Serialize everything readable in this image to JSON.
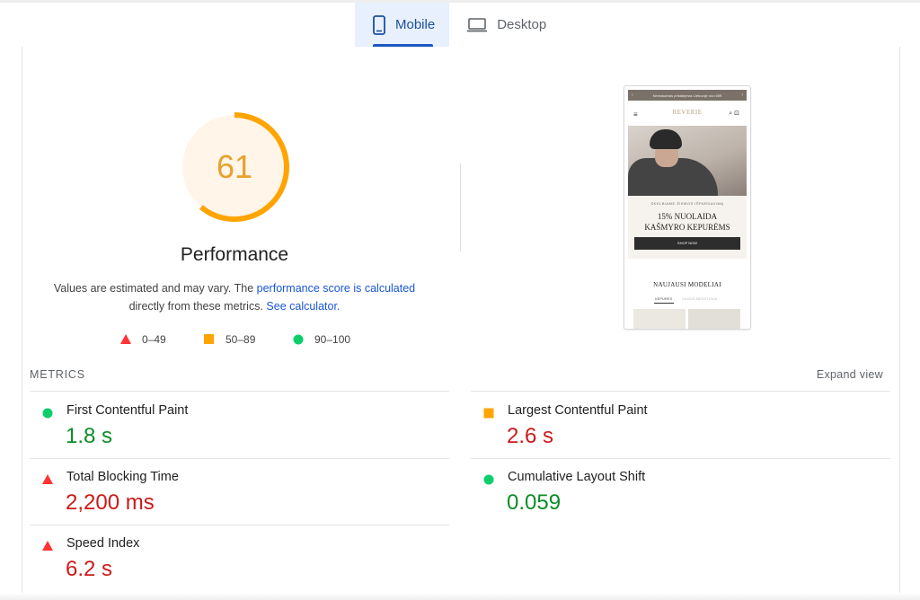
{
  "tabs": [
    {
      "label": "Mobile",
      "icon": "smartphone-icon",
      "active": true
    },
    {
      "label": "Desktop",
      "icon": "laptop-icon",
      "active": false
    }
  ],
  "score": {
    "value": 61,
    "fraction": 0.61,
    "color": "#ffa400"
  },
  "performance": {
    "title": "Performance",
    "desc_pre": "Values are estimated and may vary. The ",
    "desc_link1": "performance score is calculated",
    "desc_mid": "directly from these metrics. ",
    "desc_link2": "See calculator."
  },
  "legend": [
    {
      "label": "0–49",
      "shape": "triangle",
      "color": "#ff3333"
    },
    {
      "label": "50–89",
      "shape": "square",
      "color": "#ffa400"
    },
    {
      "label": "90–100",
      "shape": "circle",
      "color": "#0cce6b"
    }
  ],
  "preview": {
    "banner": "Nemokamas pristatymas Lietuvoje nuo 60€",
    "banner_prev": "‹",
    "banner_next": "›",
    "logo": "REVERIE",
    "menu_icon": "≡",
    "icons": "⌕ ⊡",
    "promo_small": "SKELBIAME ŽIEMOS IŠPARDAVIMĄ",
    "promo_line1": "15% NUOLAIDA",
    "promo_line2": "KAŠMYRO KEPURĖMS",
    "shop_now": "SHOP NOW",
    "new_models": "NAUJAUSI MODELIAI",
    "tab1": "KEPURĖS",
    "tab2": "VILNOS MEGZTUKAI"
  },
  "metrics": {
    "header": "METRICS",
    "expand": "Expand view",
    "items": [
      {
        "label": "First Contentful Paint",
        "value": "1.8 s",
        "rating": "good"
      },
      {
        "label": "Largest Contentful Paint",
        "value": "2.6 s",
        "rating": "average"
      },
      {
        "label": "Total Blocking Time",
        "value": "2,200 ms",
        "rating": "poor"
      },
      {
        "label": "Cumulative Layout Shift",
        "value": "0.059",
        "rating": "good"
      },
      {
        "label": "Speed Index",
        "value": "6.2 s",
        "rating": "poor"
      }
    ]
  },
  "colors": {
    "good": "#0cce6b",
    "average": "#ffa400",
    "poor": "#ff3333",
    "good_text": "#0c8c26",
    "poor_text": "#cc1a1a",
    "link": "#1a56db",
    "tab_active_bg": "#e8f0fe"
  }
}
